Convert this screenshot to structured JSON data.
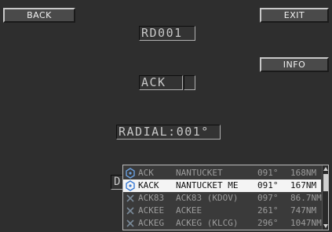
{
  "header": {
    "back_label": "BACK",
    "exit_label": "EXIT",
    "info_label": "INFO"
  },
  "fields": {
    "ident": "RD001",
    "waypoint": "ACK",
    "radial": "RADIAL:001°",
    "distance_prefix": "D"
  },
  "waypoint_list": {
    "rows": [
      {
        "icon": "vor-dme-icon",
        "ident": "ACK",
        "name": "NANTUCKET",
        "bearing": "091°",
        "distance": "168NM",
        "selected": false
      },
      {
        "icon": "vor-dme-icon",
        "ident": "KACK",
        "name": "NANTUCKET ME",
        "bearing": "091°",
        "distance": "167NM",
        "selected": true
      },
      {
        "icon": "intersection-x-icon",
        "ident": "ACK83",
        "name": "ACK83 (KDOV)",
        "bearing": "097°",
        "distance": "86.7NM",
        "selected": false
      },
      {
        "icon": "intersection-x-icon",
        "ident": "ACKEE",
        "name": "ACKEE",
        "bearing": "261°",
        "distance": "747NM",
        "selected": false
      },
      {
        "icon": "intersection-x-icon",
        "ident": "ACKEG",
        "name": "ACKEG (KLCG)",
        "bearing": "296°",
        "distance": "1047NM",
        "selected": false
      }
    ]
  },
  "colors": {
    "background": "#2e2e2e",
    "selected_row": "#f4f4f4",
    "list_text": "#9c9c9c"
  }
}
